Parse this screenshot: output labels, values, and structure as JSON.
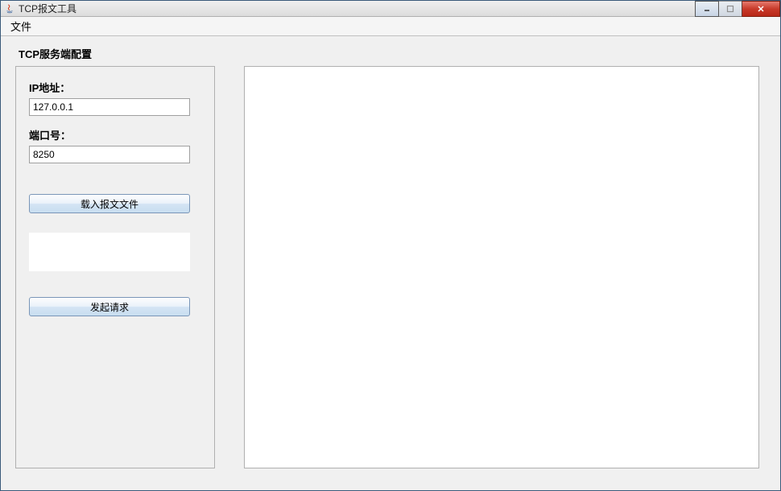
{
  "window": {
    "title": "TCP报文工具"
  },
  "menu": {
    "file": "文件"
  },
  "config": {
    "section_title": "TCP服务端配置",
    "ip_label": "IP地址：",
    "ip_value": "127.0.0.1",
    "port_label": "端口号：",
    "port_value": "8250",
    "load_button": "载入报文文件",
    "send_button": "发起请求"
  }
}
